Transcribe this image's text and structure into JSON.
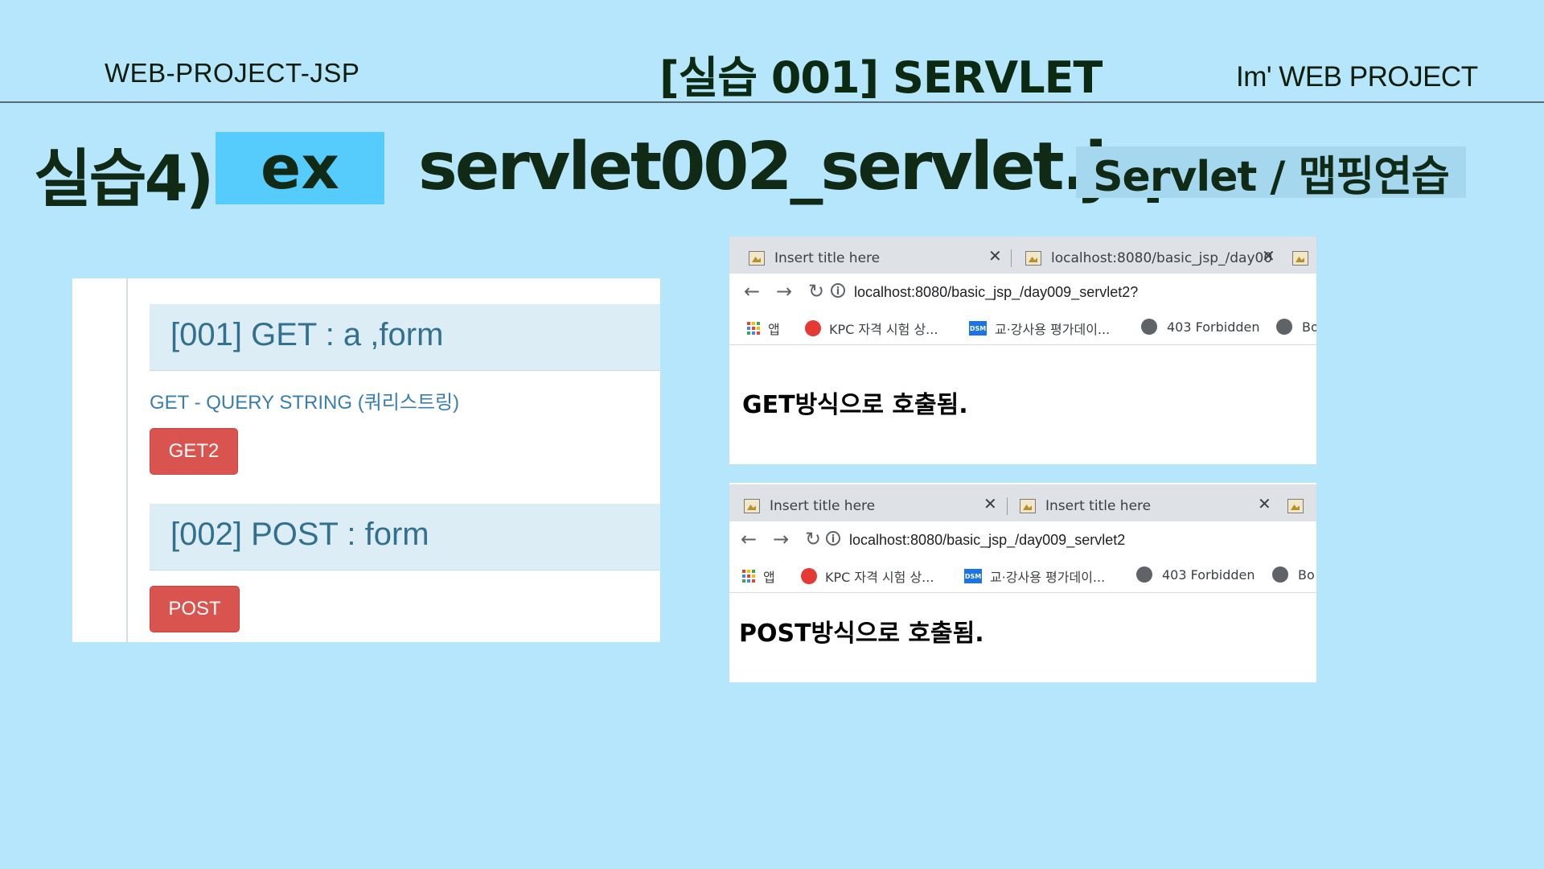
{
  "header": {
    "left": "WEB-PROJECT-JSP",
    "center": "[실습 001]  SERVLET",
    "right": "Im'  WEB PROJECT"
  },
  "title": {
    "lab": "실습4)",
    "ex": "ex",
    "file": "servlet002_servlet.jsp",
    "subtitle": "Servlet / 맵핑연습"
  },
  "left_panel": {
    "section1_title": "[001] GET : a ,form",
    "query_label": "GET - QUERY STRING (쿼리스트링)",
    "get_button": "GET2",
    "section2_title": "[002] POST : form",
    "post_button": "POST"
  },
  "browser_get": {
    "tab1": "Insert title here",
    "tab2": "localhost:8080/basic_jsp_/day00",
    "url": "localhost:8080/basic_jsp_/day009_servlet2?",
    "body_text": "GET방식으로 호출됨."
  },
  "browser_post": {
    "tab1": "Insert title here",
    "tab2": "Insert title here",
    "url": "localhost:8080/basic_jsp_/day009_servlet2",
    "body_text": "POST방식으로 호출됨."
  },
  "bookmarks": {
    "apps": "앱",
    "kpc": "KPC 자격 시험 상...",
    "dsm": "교·강사용 평가데이...",
    "forbidden": "403 Forbidden",
    "bo": "Bo"
  },
  "icons": {
    "back": "back-arrow-icon",
    "forward": "forward-arrow-icon",
    "reload": "reload-icon",
    "info": "info-icon"
  }
}
